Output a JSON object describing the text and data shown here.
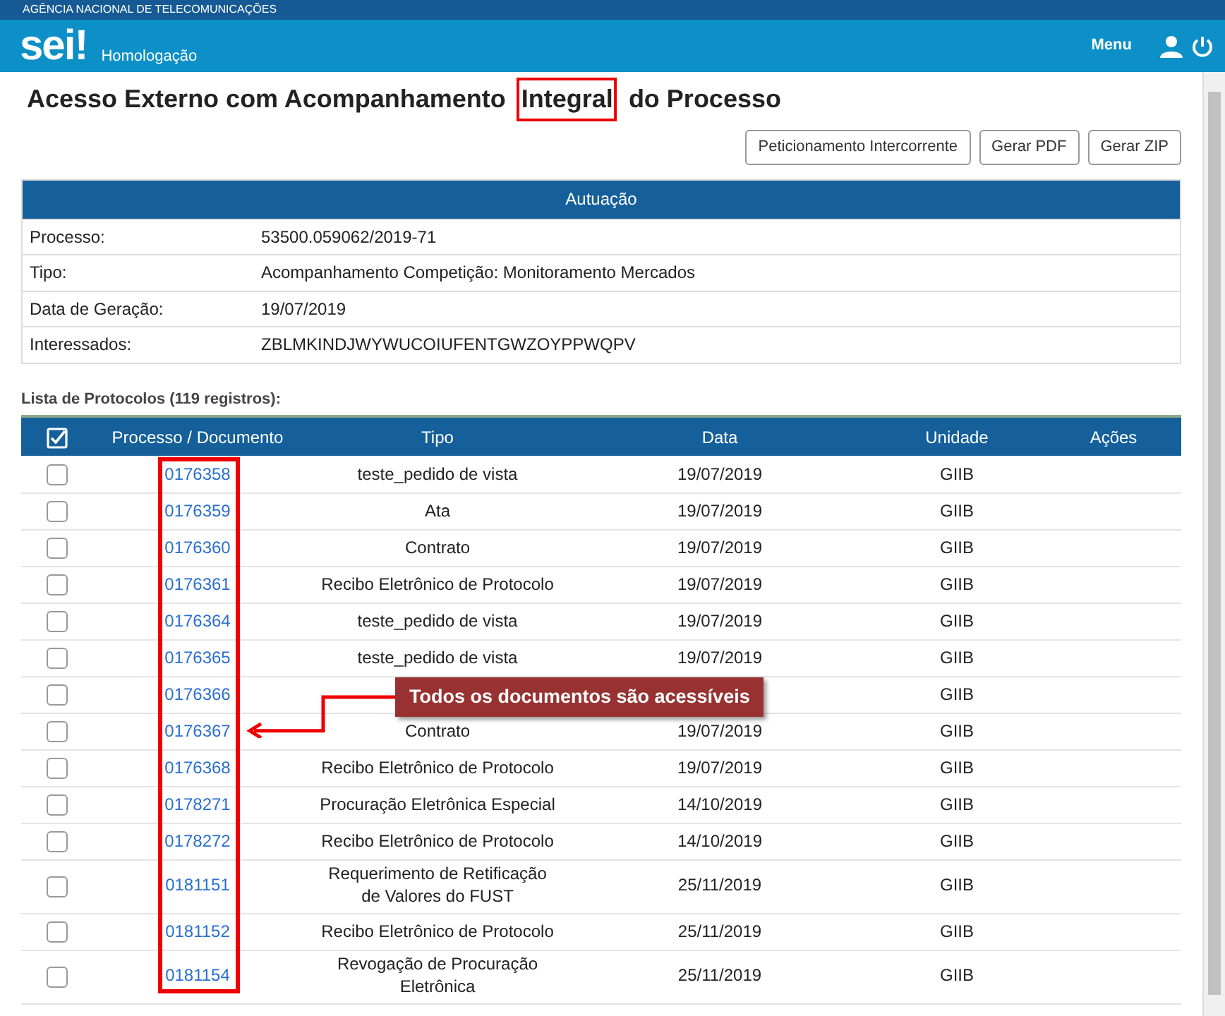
{
  "agency": "AGÊNCIA NACIONAL DE TELECOMUNICAÇÕES",
  "header": {
    "logo": "sei!",
    "environment": "Homologação",
    "menu": "Menu"
  },
  "title_parts": [
    {
      "text": "Acesso Externo com Acompanhamento",
      "highlighted": false
    },
    {
      "text": "Integral",
      "highlighted": true
    },
    {
      "text": "do Processo",
      "highlighted": false
    }
  ],
  "buttons": [
    "Peticionamento Intercorrente",
    "Gerar PDF",
    "Gerar ZIP"
  ],
  "autuacao": {
    "title": "Autuação",
    "rows": [
      {
        "label": "Processo:",
        "value": "53500.059062/2019-71"
      },
      {
        "label": "Tipo:",
        "value": "Acompanhamento Competição: Monitoramento Mercados"
      },
      {
        "label": "Data de Geração:",
        "value": "19/07/2019"
      },
      {
        "label": "Interessados:",
        "value": "ZBLMKINDJWYWUCOIUFENTGWZOYPPWQPV"
      }
    ]
  },
  "list_title": "Lista de Protocolos (119 registros):",
  "table": {
    "select_all_checked": true,
    "columns": [
      "Processo / Documento",
      "Tipo",
      "Data",
      "Unidade",
      "Ações"
    ],
    "rows": [
      {
        "checked": false,
        "document": "0176358",
        "tipo": "teste_pedido de vista",
        "data": "19/07/2019",
        "unidade": "GIIB"
      },
      {
        "checked": false,
        "document": "0176359",
        "tipo": "Ata",
        "data": "19/07/2019",
        "unidade": "GIIB"
      },
      {
        "checked": false,
        "document": "0176360",
        "tipo": "Contrato",
        "data": "19/07/2019",
        "unidade": "GIIB"
      },
      {
        "checked": false,
        "document": "0176361",
        "tipo": "Recibo Eletrônico de Protocolo",
        "data": "19/07/2019",
        "unidade": "GIIB"
      },
      {
        "checked": false,
        "document": "0176364",
        "tipo": "teste_pedido de vista",
        "data": "19/07/2019",
        "unidade": "GIIB"
      },
      {
        "checked": false,
        "document": "0176365",
        "tipo": "teste_pedido de vista",
        "data": "19/07/2019",
        "unidade": "GIIB"
      },
      {
        "checked": false,
        "document": "0176366",
        "unidade": "GIIB"
      },
      {
        "checked": false,
        "document": "0176367",
        "tipo": "Contrato",
        "data": "19/07/2019",
        "unidade": "GIIB"
      },
      {
        "checked": false,
        "document": "0176368",
        "tipo": "Recibo Eletrônico de Protocolo",
        "data": "19/07/2019",
        "unidade": "GIIB"
      },
      {
        "checked": false,
        "document": "0178271",
        "tipo": "Procuração Eletrônica Especial",
        "data": "14/10/2019",
        "unidade": "GIIB"
      },
      {
        "checked": false,
        "document": "0178272",
        "tipo": "Recibo Eletrônico de Protocolo",
        "data": "14/10/2019",
        "unidade": "GIIB"
      },
      {
        "checked": false,
        "document": "0181151",
        "tipo": "Requerimento de Retificação de Valores do FUST",
        "data": "25/11/2019",
        "unidade": "GIIB"
      },
      {
        "checked": false,
        "document": "0181152",
        "tipo": "Recibo Eletrônico de Protocolo",
        "data": "25/11/2019",
        "unidade": "GIIB"
      },
      {
        "checked": false,
        "document": "0181154",
        "tipo": "Revogação de Procuração Eletrônica",
        "data": "25/11/2019",
        "unidade": "GIIB"
      }
    ]
  },
  "callout": "Todos os documentos são acessíveis"
}
